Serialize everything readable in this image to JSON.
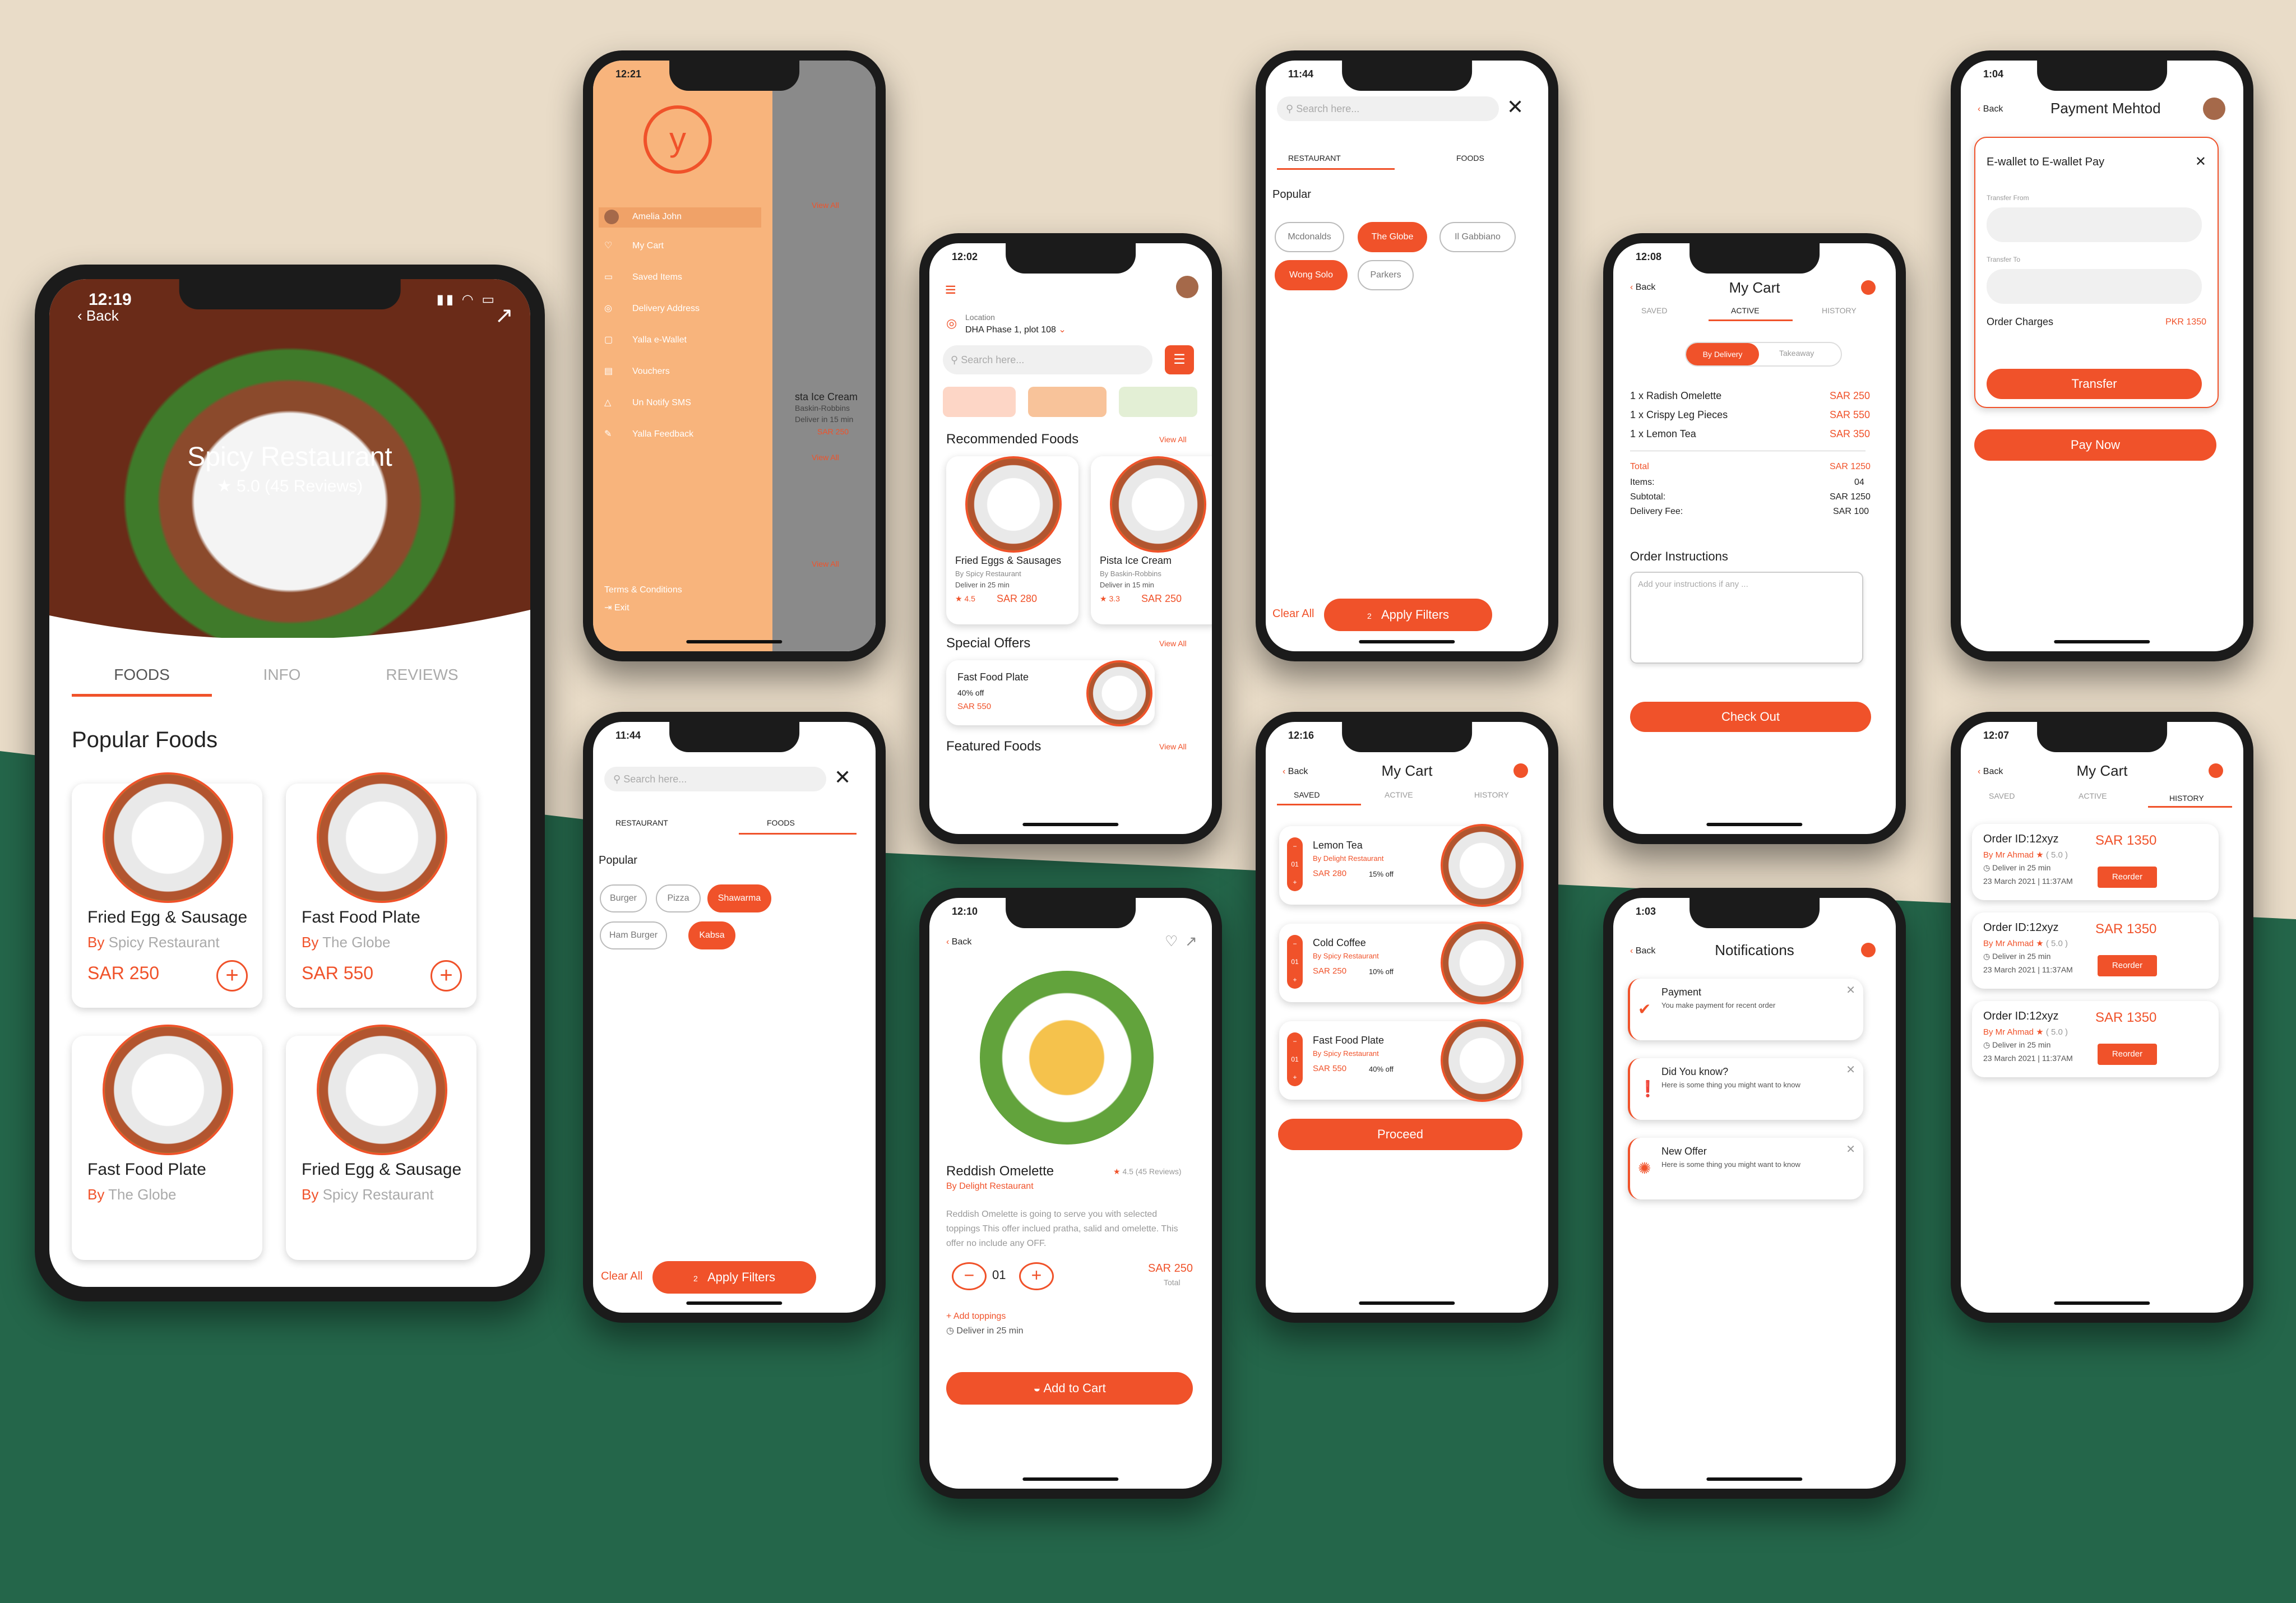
{
  "colors": {
    "accent": "#f0522a",
    "background_top": "#e9dcc8",
    "background_bottom": "#24664a",
    "menu_panel": "#f8b47c"
  },
  "p1": {
    "time": "12:19",
    "back": "Back",
    "restaurant": "Spicy Restaurant",
    "rating": "★ 5.0 (45 Reviews)",
    "tabs": [
      "FOODS",
      "INFO",
      "REVIEWS"
    ],
    "section": "Popular Foods",
    "items": [
      {
        "name": "Fried Egg & Sausage",
        "by": "By",
        "place": "Spicy Restaurant",
        "price": "SAR 250"
      },
      {
        "name": "Fast Food Plate",
        "by": "By",
        "place": "The Globe",
        "price": "SAR 550"
      },
      {
        "name": "Fast Food Plate",
        "by": "By",
        "place": "The Globe",
        "price": ""
      },
      {
        "name": "Fried Egg & Sausage",
        "by": "By",
        "place": "Spicy Restaurant",
        "price": ""
      }
    ]
  },
  "p2": {
    "time": "12:21",
    "menu": [
      "Amelia John",
      "My Cart",
      "Saved Items",
      "Delivery Address",
      "Yalla e-Wallet",
      "Vouchers",
      "Un Notify SMS",
      "Yalla Feedback"
    ],
    "terms": "Terms & Conditions",
    "exit": "Exit",
    "peek": [
      "View All",
      "sta Ice Cream",
      "Baskin-Robbins",
      "Deliver in 15 min",
      "SAR 250",
      "View All",
      "View All"
    ]
  },
  "p3": {
    "time": "11:44",
    "search": "Search here...",
    "tabs": [
      "RESTAURANT",
      "FOODS"
    ],
    "popular": "Popular",
    "chips": [
      "Burger",
      "Pizza",
      "Shawarma",
      "Ham Burger",
      "Kabsa"
    ],
    "clear": "Clear All",
    "apply": "Apply Filters",
    "count": "2"
  },
  "p4": {
    "time": "12:02",
    "loc_label": "Location",
    "loc": "DHA Phase 1, plot 108",
    "search": "Search here...",
    "rec": "Recommended Foods",
    "view": "View All",
    "rec_items": [
      {
        "name": "Fried Eggs & Sausages",
        "by": "By Spicy Restaurant",
        "del": "Deliver in 25 min",
        "rate": "4.5",
        "price": "SAR 280"
      },
      {
        "name": "Pista Ice Cream",
        "by": "By Baskin-Robbins",
        "del": "Deliver in 15 min",
        "rate": "3.3",
        "price": "SAR 250"
      }
    ],
    "special": "Special Offers",
    "offer": {
      "name": "Fast Food Plate",
      "off": "40% off",
      "price": "SAR 550"
    },
    "featured": "Featured Foods"
  },
  "p5": {
    "time": "12:10",
    "back": "Back",
    "name": "Reddish Omelette",
    "rating": "4.5 (45 Reviews)",
    "by": "By Delight Restaurant",
    "desc": "Reddish Omelette is going to serve you with selected toppings This offer inclued pratha, salid and omelette. This offer no include any OFF.",
    "qty": "01",
    "price": "SAR 250",
    "total": "Total",
    "toppings": "Add toppings",
    "deliver": "Deliver in 25 min",
    "cart": "Add to Cart"
  },
  "p6": {
    "time": "11:44",
    "search": "Search here...",
    "tabs": [
      "RESTAURANT",
      "FOODS"
    ],
    "popular": "Popular",
    "chips": [
      "Mcdonalds",
      "The Globe",
      "Il Gabbiano",
      "Wong Solo",
      "Parkers"
    ],
    "clear": "Clear All",
    "apply": "Apply Filters",
    "count": "2"
  },
  "p7": {
    "time": "12:16",
    "back": "Back",
    "title": "My Cart",
    "tabs": [
      "SAVED",
      "ACTIVE",
      "HISTORY"
    ],
    "items": [
      {
        "name": "Lemon Tea",
        "by": "By Delight Restaurant",
        "price": "SAR 280",
        "off": "15% off"
      },
      {
        "name": "Cold Coffee",
        "by": "By Spicy Restaurant",
        "price": "SAR 250",
        "off": "10% off"
      },
      {
        "name": "Fast Food Plate",
        "by": "By Spicy Restaurant",
        "price": "SAR 550",
        "off": "40% off"
      }
    ],
    "qty": "01",
    "proceed": "Proceed"
  },
  "p8": {
    "time": "12:08",
    "back": "Back",
    "title": "My Cart",
    "tabs": [
      "SAVED",
      "ACTIVE",
      "HISTORY"
    ],
    "mode": [
      "By Delivery",
      "Takeaway"
    ],
    "lines": [
      {
        "q": "1 x",
        "n": "Radish Omelette",
        "p": "SAR 250"
      },
      {
        "q": "1 x",
        "n": "Crispy Leg Pieces",
        "p": "SAR 550"
      },
      {
        "q": "1 x",
        "n": "Lemon Tea",
        "p": "SAR 350"
      }
    ],
    "total_l": "Total",
    "total": "SAR 1250",
    "items_l": "Items:",
    "items": "04",
    "sub_l": "Subtotal:",
    "sub": "SAR 1250",
    "fee_l": "Delivery Fee:",
    "fee": "SAR 100",
    "instr": "Order Instructions",
    "instr_ph": "Add your instructions if any ...",
    "checkout": "Check Out"
  },
  "p9": {
    "time": "1:03",
    "back": "Back",
    "title": "Notifications",
    "notes": [
      {
        "t": "Payment",
        "d": "You make payment for recent order"
      },
      {
        "t": "Did You know?",
        "d": "Here is some thing you might want to know"
      },
      {
        "t": "New Offer",
        "d": "Here is some thing you might want to know"
      }
    ]
  },
  "p10": {
    "time": "1:04",
    "back": "Back",
    "title": "Payment Mehtod",
    "modal": "E-wallet to E-wallet Pay",
    "from": "Transfer From",
    "to": "Transfer To",
    "charges": "Order Charges",
    "amount": "PKR 1350",
    "transfer": "Transfer",
    "pay": "Pay Now"
  },
  "p11": {
    "time": "12:07",
    "back": "Back",
    "title": "My Cart",
    "tabs": [
      "SAVED",
      "ACTIVE",
      "HISTORY"
    ],
    "order": {
      "id": "Order ID:12xyz",
      "price": "SAR 1350",
      "by": "By Mr Ahmad",
      "rate": "( 5.0 )",
      "del": "Deliver in 25 min",
      "date": "23 March 2021",
      "time": "11:37AM",
      "btn": "Reorder"
    }
  }
}
